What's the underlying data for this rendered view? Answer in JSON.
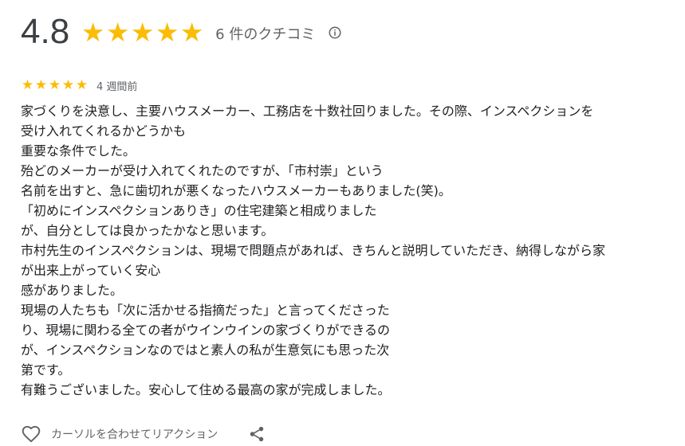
{
  "summary": {
    "rating": "4.8",
    "star_count": 5,
    "star_glyph": "★",
    "review_count_label": "6 件のクチコミ",
    "info_icon": "info-icon"
  },
  "review": {
    "star_count": 5,
    "star_glyph": "★",
    "date": "4 週間前",
    "lines": [
      "家づくりを決意し、主要ハウスメーカー、工務店を十数社回りました。その際、インスペクションを",
      "受け入れてくれるかどうかも",
      "重要な条件でした。",
      "殆どのメーカーが受け入れてくれたのですが、「市村崇」という",
      "名前を出すと、急に歯切れが悪くなったハウスメーカーもありました(笑)。",
      "「初めにインスペクションありき」の住宅建築と相成りました",
      "が、自分としては良かったかなと思います。",
      "市村先生のインスペクションは、現場で問題点があれば、きちんと説明していただき、納得しながら家",
      "が出来上がっていく安心",
      "感がありました。",
      "現場の人たちも「次に活かせる指摘だった」と言ってくださった",
      "り、現場に関わる全ての者がウインウインの家づくりができるの",
      "が、インスペクションなのではと素人の私が生意気にも思った次",
      "第です。",
      "有難うございました。安心して住める最高の家が完成しました。"
    ]
  },
  "actions": {
    "reaction_label": "カーソルを合わせてリアクション",
    "reaction_icon": "heart-icon",
    "share_icon": "share-icon"
  },
  "colors": {
    "star": "#fbbc04",
    "text": "#202124",
    "muted": "#5f6368"
  }
}
